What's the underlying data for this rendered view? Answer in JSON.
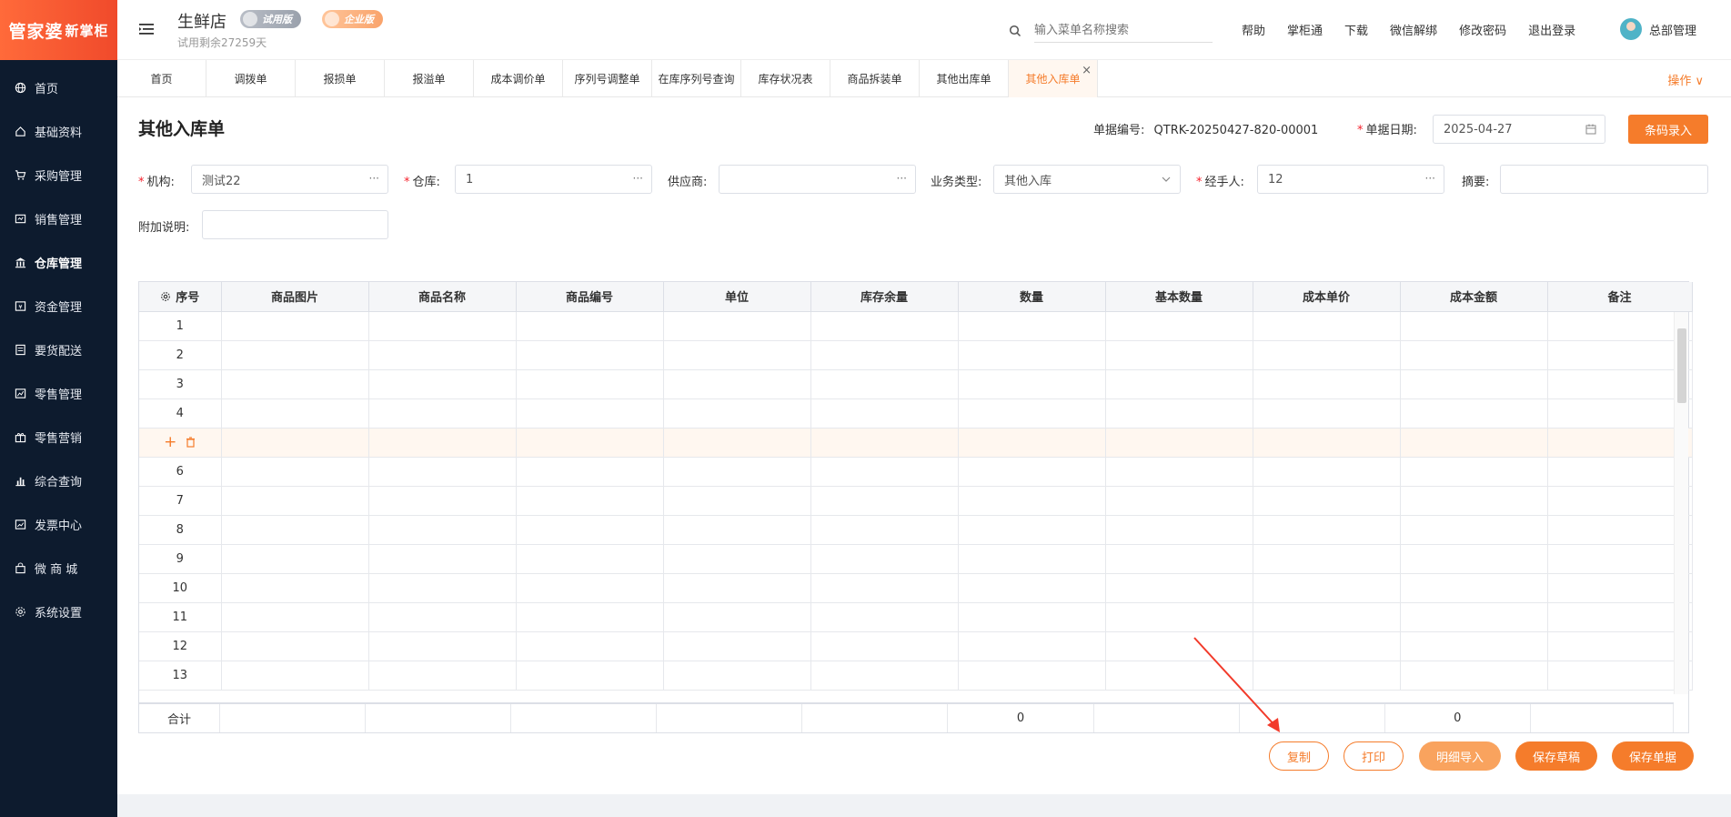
{
  "logo": {
    "main": "管家婆",
    "sub": "新掌柜"
  },
  "sidebar": {
    "items": [
      {
        "label": "首页",
        "icon": "globe-icon"
      },
      {
        "label": "基础资料",
        "icon": "home-icon"
      },
      {
        "label": "采购管理",
        "icon": "cart-icon"
      },
      {
        "label": "销售管理",
        "icon": "sales-icon"
      },
      {
        "label": "仓库管理",
        "icon": "warehouse-icon"
      },
      {
        "label": "资金管理",
        "icon": "money-icon"
      },
      {
        "label": "要货配送",
        "icon": "delivery-icon"
      },
      {
        "label": "零售管理",
        "icon": "retail-icon"
      },
      {
        "label": "零售营销",
        "icon": "gift-icon"
      },
      {
        "label": "综合查询",
        "icon": "chart-icon"
      },
      {
        "label": "发票中心",
        "icon": "invoice-icon"
      },
      {
        "label": "微 商 城",
        "icon": "bag-icon"
      },
      {
        "label": "系统设置",
        "icon": "gear-icon"
      }
    ],
    "active_index": 4
  },
  "header": {
    "store_name": "生鲜店",
    "trial_text": "试用剩余27259天",
    "badge_trial": "试用版",
    "badge_pro": "企业版",
    "search_placeholder": "输入菜单名称搜索",
    "links": [
      "帮助",
      "掌柜通",
      "下载",
      "微信解绑",
      "修改密码",
      "退出登录"
    ],
    "user": "总部管理"
  },
  "tabs": {
    "items": [
      "首页",
      "调拨单",
      "报损单",
      "报溢单",
      "成本调价单",
      "序列号调整单",
      "在库序列号查询",
      "库存状况表",
      "商品拆装单",
      "其他出库单",
      "其他入库单"
    ],
    "active_index": 10,
    "ops_label": "操作 ∨",
    "close_glyph": "×"
  },
  "form": {
    "title": "其他入库单",
    "doc_no_label": "单据编号:",
    "doc_no": "QTRK-20250427-820-00001",
    "date_label": "单据日期:",
    "date": "2025-04-27",
    "barcode_button": "条码录入",
    "org_label": "机构:",
    "org_value": "测试22",
    "warehouse_label": "仓库:",
    "warehouse_value": "1",
    "supplier_label": "供应商:",
    "supplier_value": "",
    "biz_type_label": "业务类型:",
    "biz_type_value": "其他入库",
    "handler_label": "经手人:",
    "handler_value": "12",
    "summary_label": "摘要:",
    "summary_value": "",
    "extra_label": "附加说明:",
    "extra_value": ""
  },
  "table": {
    "columns": [
      "序号",
      "商品图片",
      "商品名称",
      "商品编号",
      "单位",
      "库存余量",
      "数量",
      "基本数量",
      "成本单价",
      "成本金额",
      "备注"
    ],
    "rows": [
      "1",
      "2",
      "3",
      "4",
      "",
      "6",
      "7",
      "8",
      "9",
      "10",
      "11",
      "12",
      "13"
    ],
    "hover_row_index": 4,
    "row_action_add": "+",
    "sum_label": "合计",
    "sum_qty": "0",
    "sum_amount": "0"
  },
  "actions": {
    "copy": "复制",
    "print": "打印",
    "import": "明细导入",
    "save_draft": "保存草稿",
    "save": "保存单据"
  },
  "colors": {
    "accent": "#f57c2b",
    "sidebar_bg": "#0d1b2e",
    "logo_bg": "#f04a2b"
  }
}
